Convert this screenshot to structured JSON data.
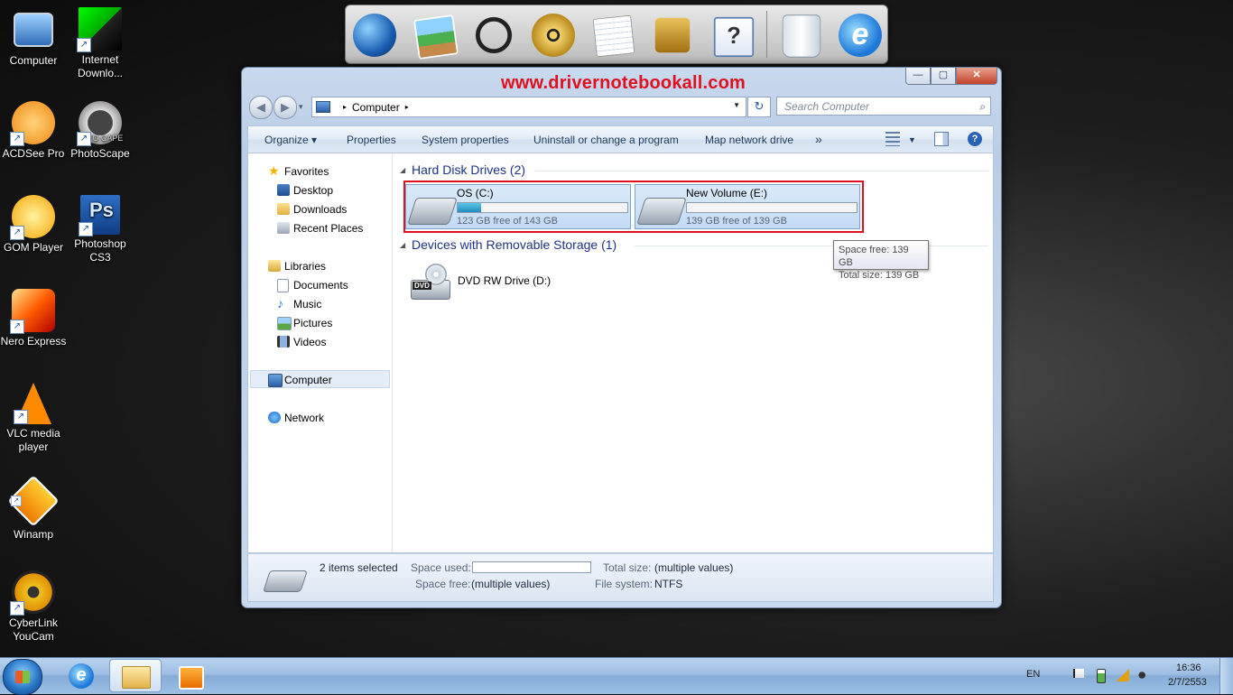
{
  "desktop": {
    "icons": [
      {
        "label": "Computer",
        "icon": "computer-icon"
      },
      {
        "label": "Internet Downlo...",
        "icon": "internet-download-manager-icon"
      },
      {
        "label": "ACDSee Pro",
        "icon": "acdsee-pro-icon"
      },
      {
        "label": "PhotoScape",
        "icon": "photoscape-icon"
      },
      {
        "label": "GOM Player",
        "icon": "gom-player-icon"
      },
      {
        "label": "Photoshop CS3",
        "icon": "photoshop-icon"
      },
      {
        "label": "Nero Express",
        "icon": "nero-express-icon"
      },
      {
        "label": "VLC media player",
        "icon": "vlc-icon"
      },
      {
        "label": "Winamp",
        "icon": "winamp-icon"
      },
      {
        "label": "CyberLink YouCam",
        "icon": "youcam-icon"
      }
    ],
    "shortcut_arrow": "↗",
    "photoshop_glyph": "Ps",
    "photoscape_badge": "TO CAPE"
  },
  "dock": {
    "items": [
      "globe-icon",
      "photos-icon",
      "headphones-icon",
      "film-reel-icon",
      "notes-icon",
      "lock-icon",
      "help-icon",
      "recycle-bin-icon",
      "internet-explorer-icon"
    ],
    "help_glyph": "?",
    "ie_glyph": "e"
  },
  "window": {
    "watermark": "www.drivernotebookall.com",
    "caption": {
      "minimize": "—",
      "maximize": "▢",
      "close": "✕"
    },
    "nav": {
      "back": "◀",
      "forward": "▶",
      "recent_dropdown": "▾"
    },
    "address": {
      "segment": "Computer",
      "sep": "▸",
      "dropdown": "▼"
    },
    "refresh": "↻",
    "search": {
      "placeholder": "Search Computer",
      "icon": "⌕"
    },
    "toolbar": {
      "organize": "Organize ▾",
      "items": [
        "Properties",
        "System properties",
        "Uninstall or change a program",
        "Map network drive"
      ],
      "more": "»",
      "view_dropdown": "▼",
      "help": "?"
    },
    "nav_pane": {
      "favorites": "Favorites",
      "favorites_items": [
        "Desktop",
        "Downloads",
        "Recent Places"
      ],
      "libraries": "Libraries",
      "libraries_items": [
        "Documents",
        "Music",
        "Pictures",
        "Videos"
      ],
      "computer": "Computer",
      "network": "Network"
    },
    "groups": {
      "hard_disk": {
        "title": "Hard Disk Drives (2)",
        "collapse": "◢"
      },
      "removable": {
        "title": "Devices with Removable Storage (1)",
        "collapse": "◢"
      }
    },
    "drives": [
      {
        "name": "OS (C:)",
        "free_text": "123 GB free of 143 GB",
        "used_fraction": 0.14
      },
      {
        "name": "New Volume (E:)",
        "free_text": "139 GB free of 139 GB",
        "used_fraction": 0.0
      }
    ],
    "dvd": {
      "name": "DVD RW Drive (D:)",
      "badge": "DVD"
    },
    "tooltip": {
      "line1": "Space free: 139 GB",
      "line2": "Total size: 139 GB"
    },
    "details": {
      "selected": "2 items selected",
      "space_used_label": "Space used:",
      "space_free_label": "Space free:",
      "space_free_value": "(multiple values)",
      "total_size_label": "Total size:",
      "total_size_value": "(multiple values)",
      "file_system_label": "File system:",
      "file_system_value": "NTFS"
    }
  },
  "taskbar": {
    "ie_glyph": "e",
    "language": "EN",
    "time": "16:36",
    "date": "2/7/2553"
  },
  "colors": {
    "watermark": "#e0101f",
    "selection_border": "#e0101f",
    "drive_fill": "#1f8dbf",
    "group_title": "#1e3287"
  }
}
